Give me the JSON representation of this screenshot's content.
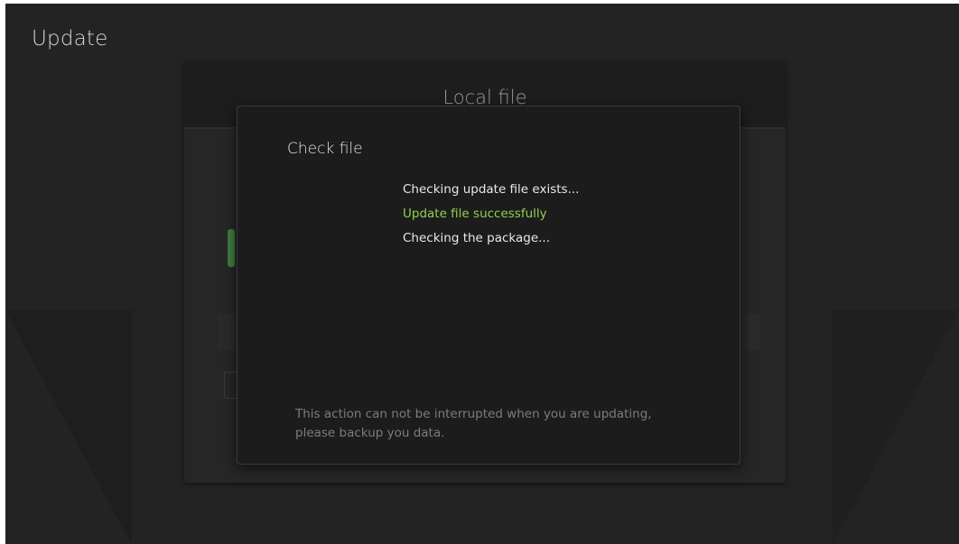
{
  "page": {
    "title": "Update"
  },
  "background_panel": {
    "title": "Local file"
  },
  "dialog": {
    "title": "Check file",
    "status_lines": [
      {
        "text": "Checking update file exists...",
        "state": "info"
      },
      {
        "text": "Update file successfully",
        "state": "success"
      },
      {
        "text": "Checking the package...",
        "state": "info"
      }
    ],
    "warning_line1": "This action can not be interrupted when you are updating,",
    "warning_line2": "please backup you data."
  },
  "colors": {
    "background": "#232323",
    "dialog_bg": "#1c1c1c",
    "success_text": "#8fd14f",
    "accent_green": "#3f7a3f",
    "muted_text": "#7c7c7c"
  }
}
